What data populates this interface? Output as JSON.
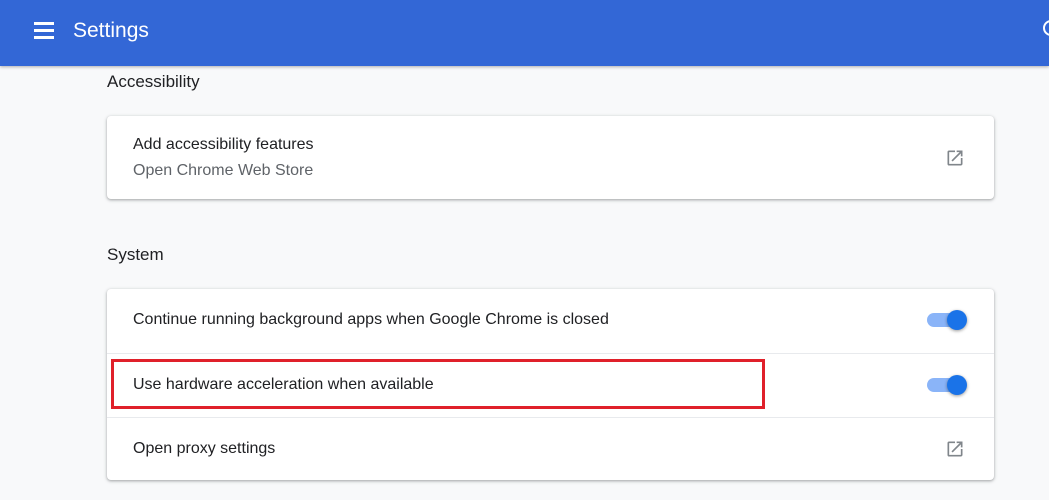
{
  "header": {
    "title": "Settings"
  },
  "accessibility": {
    "heading": "Accessibility",
    "item": {
      "title": "Add accessibility features",
      "subtitle": "Open Chrome Web Store"
    }
  },
  "system": {
    "heading": "System",
    "items": [
      {
        "label": "Continue running background apps when Google Chrome is closed",
        "enabled": true
      },
      {
        "label": "Use hardware acceleration when available",
        "enabled": true
      },
      {
        "label": "Open proxy settings"
      }
    ]
  },
  "colors": {
    "header": "#3367d6",
    "toggle": "#1a73e8",
    "highlight": "#e0202a"
  }
}
